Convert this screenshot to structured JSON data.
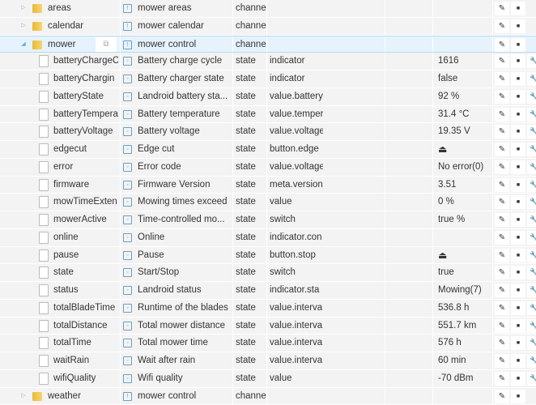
{
  "icons": {
    "expand": "triangle-right",
    "collapse": "triangle-down",
    "folder": "folder-icon",
    "file": "file-icon",
    "channel": "channel-icon",
    "state": "state-icon",
    "edit": "pencil-icon",
    "delete": "trash-icon",
    "settings": "wrench-icon",
    "copy": "copy-icon",
    "button": "eject-icon"
  },
  "rows": [
    {
      "kind": "folder",
      "name": "areas",
      "desc": "mower areas",
      "type": "channe",
      "role": "",
      "value": "",
      "icon": "!",
      "expanded": false
    },
    {
      "kind": "folder",
      "name": "calendar",
      "desc": "mower calendar",
      "type": "channe",
      "role": "",
      "value": "",
      "icon": "!",
      "expanded": false
    },
    {
      "kind": "folder",
      "name": "mower",
      "desc": "mower control",
      "type": "channe",
      "role": "",
      "value": "",
      "icon": "!",
      "expanded": true,
      "selected": true
    },
    {
      "kind": "state",
      "name": "batteryChargeC",
      "desc": "Battery charge cycle",
      "type": "state",
      "role": "indicator",
      "value": "1616"
    },
    {
      "kind": "state",
      "name": "batteryChargin",
      "desc": "Battery charger state",
      "type": "state",
      "role": "indicator",
      "value": "false"
    },
    {
      "kind": "state",
      "name": "batteryState",
      "desc": "Landroid battery sta...",
      "type": "state",
      "role": "value.battery",
      "value": "92 %"
    },
    {
      "kind": "state",
      "name": "batteryTempera",
      "desc": "Battery temperature",
      "type": "state",
      "role": "value.temper",
      "value": "31.4 °C"
    },
    {
      "kind": "state",
      "name": "batteryVoltage",
      "desc": "Battery voltage",
      "type": "state",
      "role": "value.voltage",
      "value": "19.35 V"
    },
    {
      "kind": "state",
      "name": "edgecut",
      "desc": "Edge cut",
      "type": "state",
      "role": "button.edge",
      "value": "⏏",
      "isButton": true
    },
    {
      "kind": "state",
      "name": "error",
      "desc": "Error code",
      "type": "state",
      "role": "value.voltage",
      "value": "No error(0)"
    },
    {
      "kind": "state",
      "name": "firmware",
      "desc": "Firmware Version",
      "type": "state",
      "role": "meta.version",
      "value": "3.51"
    },
    {
      "kind": "state",
      "name": "mowTimeExten",
      "desc": "Mowing times exceed",
      "type": "state",
      "role": "value",
      "value": "0 %"
    },
    {
      "kind": "state",
      "name": "mowerActive",
      "desc": "Time-controlled mo...",
      "type": "state",
      "role": "switch",
      "value": "true %"
    },
    {
      "kind": "state",
      "name": "online",
      "desc": "Online",
      "type": "state",
      "role": "indicator.con",
      "value": ""
    },
    {
      "kind": "state",
      "name": "pause",
      "desc": "Pause",
      "type": "state",
      "role": "button.stop",
      "value": "⏏",
      "isButton": true
    },
    {
      "kind": "state",
      "name": "state",
      "desc": "Start/Stop",
      "type": "state",
      "role": "switch",
      "value": "true"
    },
    {
      "kind": "state",
      "name": "status",
      "desc": "Landroid status",
      "type": "state",
      "role": "indicator.sta",
      "value": "Mowing(7)"
    },
    {
      "kind": "state",
      "name": "totalBladeTime",
      "desc": "Runtime of the blades",
      "type": "state",
      "role": "value.interva",
      "value": "536.8 h"
    },
    {
      "kind": "state",
      "name": "totalDistance",
      "desc": "Total mower distance",
      "type": "state",
      "role": "value.interva",
      "value": "551.7 km"
    },
    {
      "kind": "state",
      "name": "totalTime",
      "desc": "Total mower time",
      "type": "state",
      "role": "value.interva",
      "value": "576 h"
    },
    {
      "kind": "state",
      "name": "waitRain",
      "desc": "Wait after rain",
      "type": "state",
      "role": "value.interva",
      "value": "60 min"
    },
    {
      "kind": "state",
      "name": "wifiQuality",
      "desc": "Wifi quality",
      "type": "state",
      "role": "value",
      "value": "-70 dBm"
    },
    {
      "kind": "folder",
      "name": "weather",
      "desc": "mower control",
      "type": "channe",
      "role": "",
      "value": "",
      "icon": "!",
      "expanded": false
    }
  ]
}
